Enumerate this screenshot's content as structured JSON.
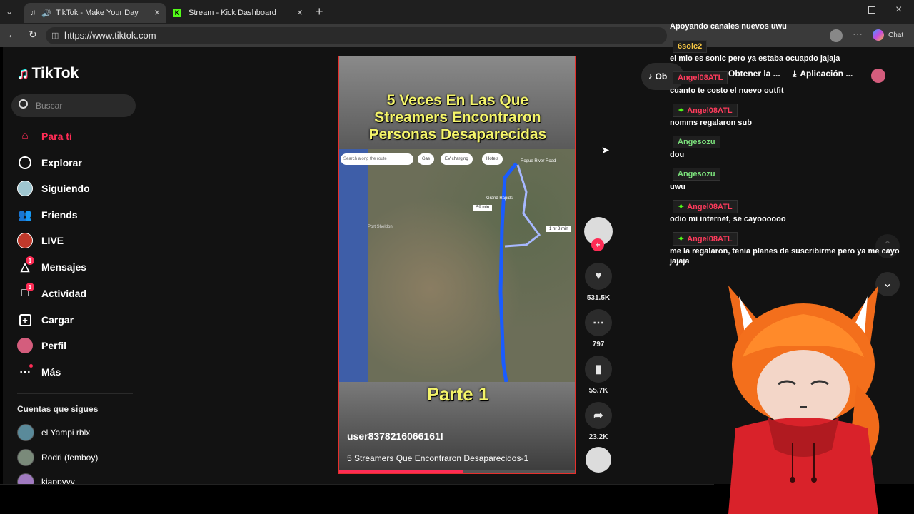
{
  "browser": {
    "tabs": [
      {
        "title": "TikTok - Make Your Day"
      },
      {
        "title": "Stream - Kick Dashboard"
      }
    ],
    "url": "https://www.tiktok.com",
    "chat_button": "Chat"
  },
  "tiktok": {
    "logo": "TikTok",
    "search_placeholder": "Buscar",
    "nav": [
      {
        "label": "Para ti",
        "icon": "home-icon"
      },
      {
        "label": "Explorar",
        "icon": "compass-icon"
      },
      {
        "label": "Siguiendo",
        "icon": "avatar"
      },
      {
        "label": "Friends",
        "icon": "friends-icon"
      },
      {
        "label": "LIVE",
        "icon": "avatar"
      },
      {
        "label": "Mensajes",
        "icon": "send-icon",
        "badge": "1"
      },
      {
        "label": "Actividad",
        "icon": "inbox-icon",
        "badge": "1"
      },
      {
        "label": "Cargar",
        "icon": "plus-square-icon"
      },
      {
        "label": "Perfil",
        "icon": "avatar"
      },
      {
        "label": "Más",
        "icon": "more-icon"
      }
    ],
    "following_header": "Cuentas que sigues",
    "following": [
      "el Yampi rblx",
      "Rodri (femboy)",
      "kiappyyy"
    ],
    "top_pills": [
      "Ob",
      "Obtener la ...",
      "Aplicación ..."
    ],
    "video": {
      "title_lines": [
        "5 Veces En Las Que",
        "Streamers Encontraron",
        "Personas Desaparecidas"
      ],
      "part": "Parte 1",
      "username": "user8378216066161l",
      "caption": "5 Streamers Que Encontraron Desaparecidos-1",
      "map": {
        "search_placeholder": "Search along the route",
        "chips": [
          "Gas",
          "EV charging",
          "Hotels"
        ],
        "route_labels": [
          "59 min",
          "1 hr 8 min"
        ],
        "place_names": [
          "Grand Rapids",
          "Rogue River Road",
          "Port Sheldon"
        ]
      }
    },
    "actions": {
      "likes": "531.5K",
      "comments": "797",
      "saves": "55.7K",
      "shares": "23.2K"
    }
  },
  "chat": [
    {
      "type": "msg",
      "text": "Apoyando canales nuevos uwu"
    },
    {
      "type": "name",
      "name": "6soic2",
      "color": "#f5c542"
    },
    {
      "type": "msg",
      "text": "el mio es sonic pero ya estaba ocuapdo jajaja"
    },
    {
      "type": "name",
      "name": "Angel08ATL",
      "color": "#ff3b5c"
    },
    {
      "type": "msg",
      "text": "cuanto te costo el nuevo outfit"
    },
    {
      "type": "name",
      "name": "Angel08ATL",
      "color": "#ff3b5c"
    },
    {
      "type": "msg",
      "text": "nomms regalaron sub"
    },
    {
      "type": "name",
      "name": "Angesozu",
      "color": "#7be07b"
    },
    {
      "type": "msg",
      "text": "dou"
    },
    {
      "type": "name",
      "name": "Angesozu",
      "color": "#7be07b"
    },
    {
      "type": "msg",
      "text": "uwu"
    },
    {
      "type": "name",
      "name": "Angel08ATL",
      "color": "#ff3b5c"
    },
    {
      "type": "msg",
      "text": "odio mi internet, se cayoooooo"
    },
    {
      "type": "name",
      "name": "Angel08ATL",
      "color": "#ff3b5c"
    },
    {
      "type": "msg",
      "text": "me la regalaron, tenia planes de suscribirme pero ya me cayo jajaja"
    }
  ]
}
